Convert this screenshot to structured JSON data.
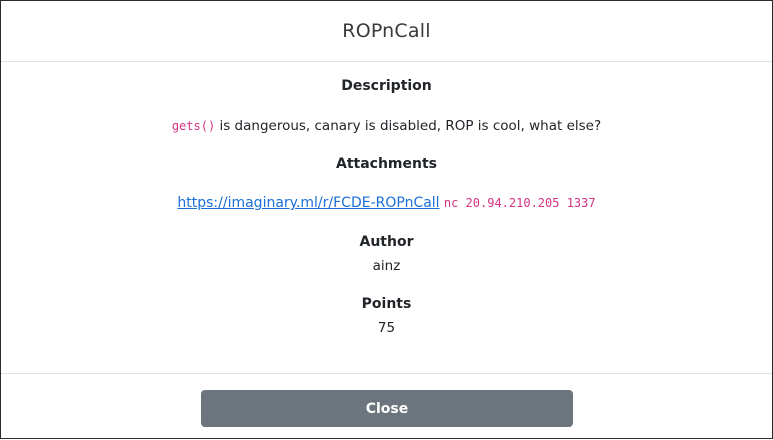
{
  "modal": {
    "title": "ROPnCall",
    "description": {
      "heading": "Description",
      "code": "gets()",
      "text": " is dangerous, canary is disabled, ROP is cool, what else?"
    },
    "attachments": {
      "heading": "Attachments",
      "link": "https://imaginary.ml/r/FCDE-ROPnCall",
      "command": "nc 20.94.210.205 1337"
    },
    "author": {
      "heading": "Author",
      "value": "ainz"
    },
    "points": {
      "heading": "Points",
      "value": "75"
    },
    "close_label": "Close"
  },
  "colors": {
    "code": "#d63384",
    "link": "#1a6fd8",
    "close_button": "#6c757d"
  }
}
